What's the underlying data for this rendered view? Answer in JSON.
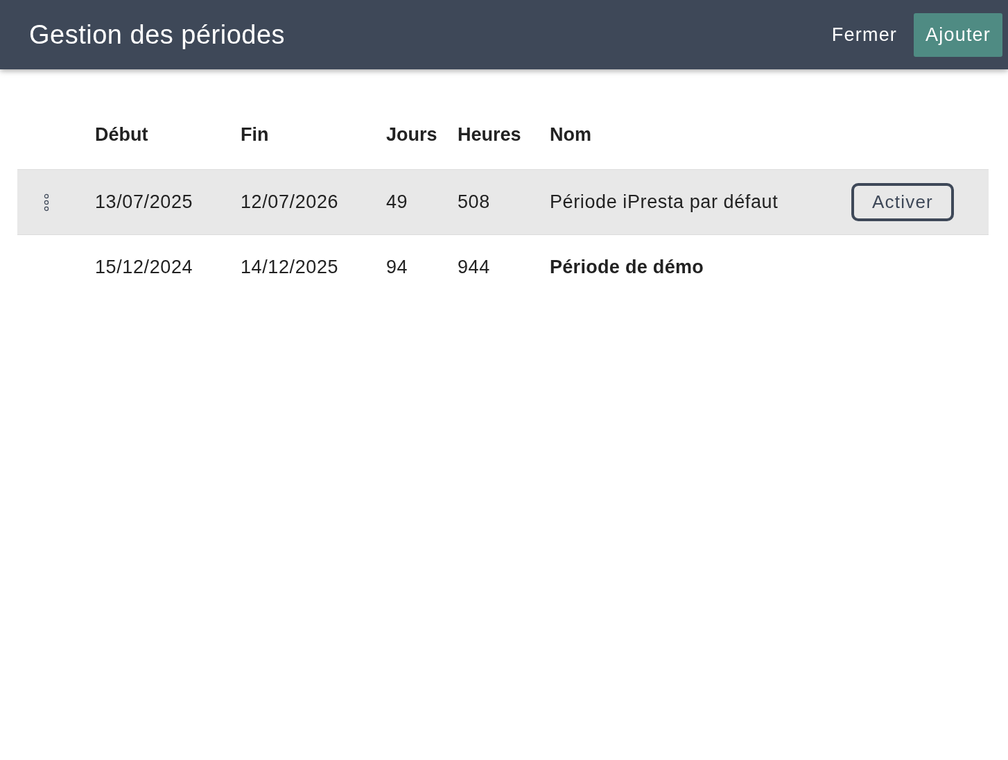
{
  "header": {
    "title": "Gestion des périodes",
    "buttons": [
      {
        "label": "Fermer",
        "kind": "text"
      },
      {
        "label": "Ajouter",
        "kind": "primary"
      }
    ]
  },
  "table": {
    "columns": [
      "Début",
      "Fin",
      "Jours",
      "Heures",
      "Nom"
    ],
    "rows": [
      {
        "start": "13/07/2025",
        "end": "12/07/2026",
        "days": "49",
        "hours": "508",
        "name": "Période iPresta par défaut",
        "selected": true,
        "active": false,
        "action": "Activer"
      },
      {
        "start": "15/12/2024",
        "end": "14/12/2025",
        "days": "94",
        "hours": "944",
        "name": "Période de démo",
        "selected": false,
        "active": true
      }
    ]
  }
}
